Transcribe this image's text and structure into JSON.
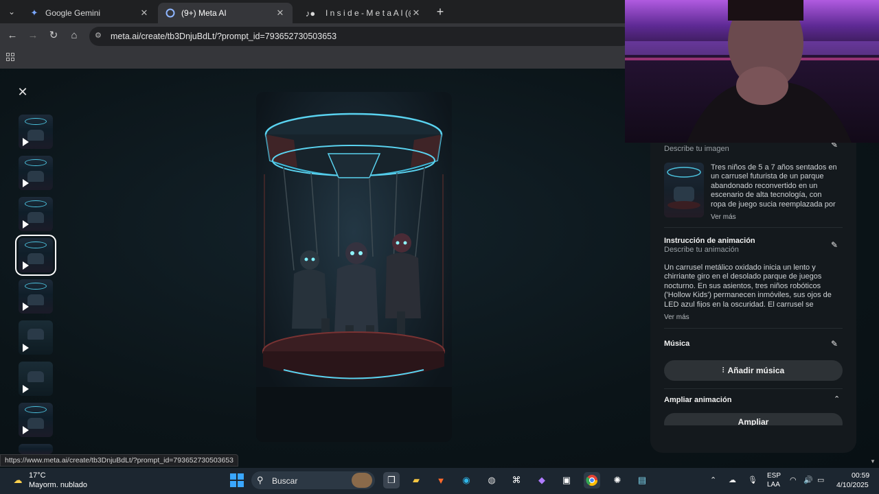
{
  "browser": {
    "tabs": [
      {
        "title": "Google Gemini",
        "active": false
      },
      {
        "title": "(9+) Meta AI",
        "active": true
      },
      {
        "title": "I n s i d e - M e t a A I (@asi",
        "active": false
      }
    ],
    "url": "meta.ai/create/tb3DnjuBdLt/?prompt_id=793652730503653",
    "status_url": "https://www.meta.ai/create/tb3DnjuBdLt/?prompt_id=793652730503653"
  },
  "panel": {
    "image_prompt_title_partial": "Describe tu imagen",
    "image_prompt_text": "Tres niños de 5 a 7 años sentados en un carrusel futurista de un parque abandonado reconvertido en un escenario de alta tecnología, con ropa de juego sucia reemplazada por",
    "image_see_more": "Ver más",
    "animation_title": "Instrucción de animación",
    "animation_sub": "Describe tu animación",
    "animation_text": "Un carrusel metálico oxidado inicia un lento y chirriante giro en el desolado parque de juegos nocturno. En sus asientos, tres niños robóticos ('Hollow Kids') permanecen inmóviles, sus ojos de LED azul fijos en la oscuridad. El carrusel se detiene",
    "animation_see_more": "Ver más",
    "music_title": "Música",
    "add_music_label": "Añadir música",
    "expand_title": "Ampliar animación",
    "expand_button": "Ampliar"
  },
  "taskbar": {
    "weather_temp": "17°C",
    "weather_desc": "Mayorm. nublado",
    "search_label": "Buscar",
    "lang_top": "ESP",
    "lang_bottom": "LAA",
    "time": "00:59",
    "date": "4/10/2025"
  },
  "colors": {
    "accent_cyan": "#4cc4e0",
    "panel_bg": "#14191d",
    "taskbar_bg": "#1c2630"
  }
}
